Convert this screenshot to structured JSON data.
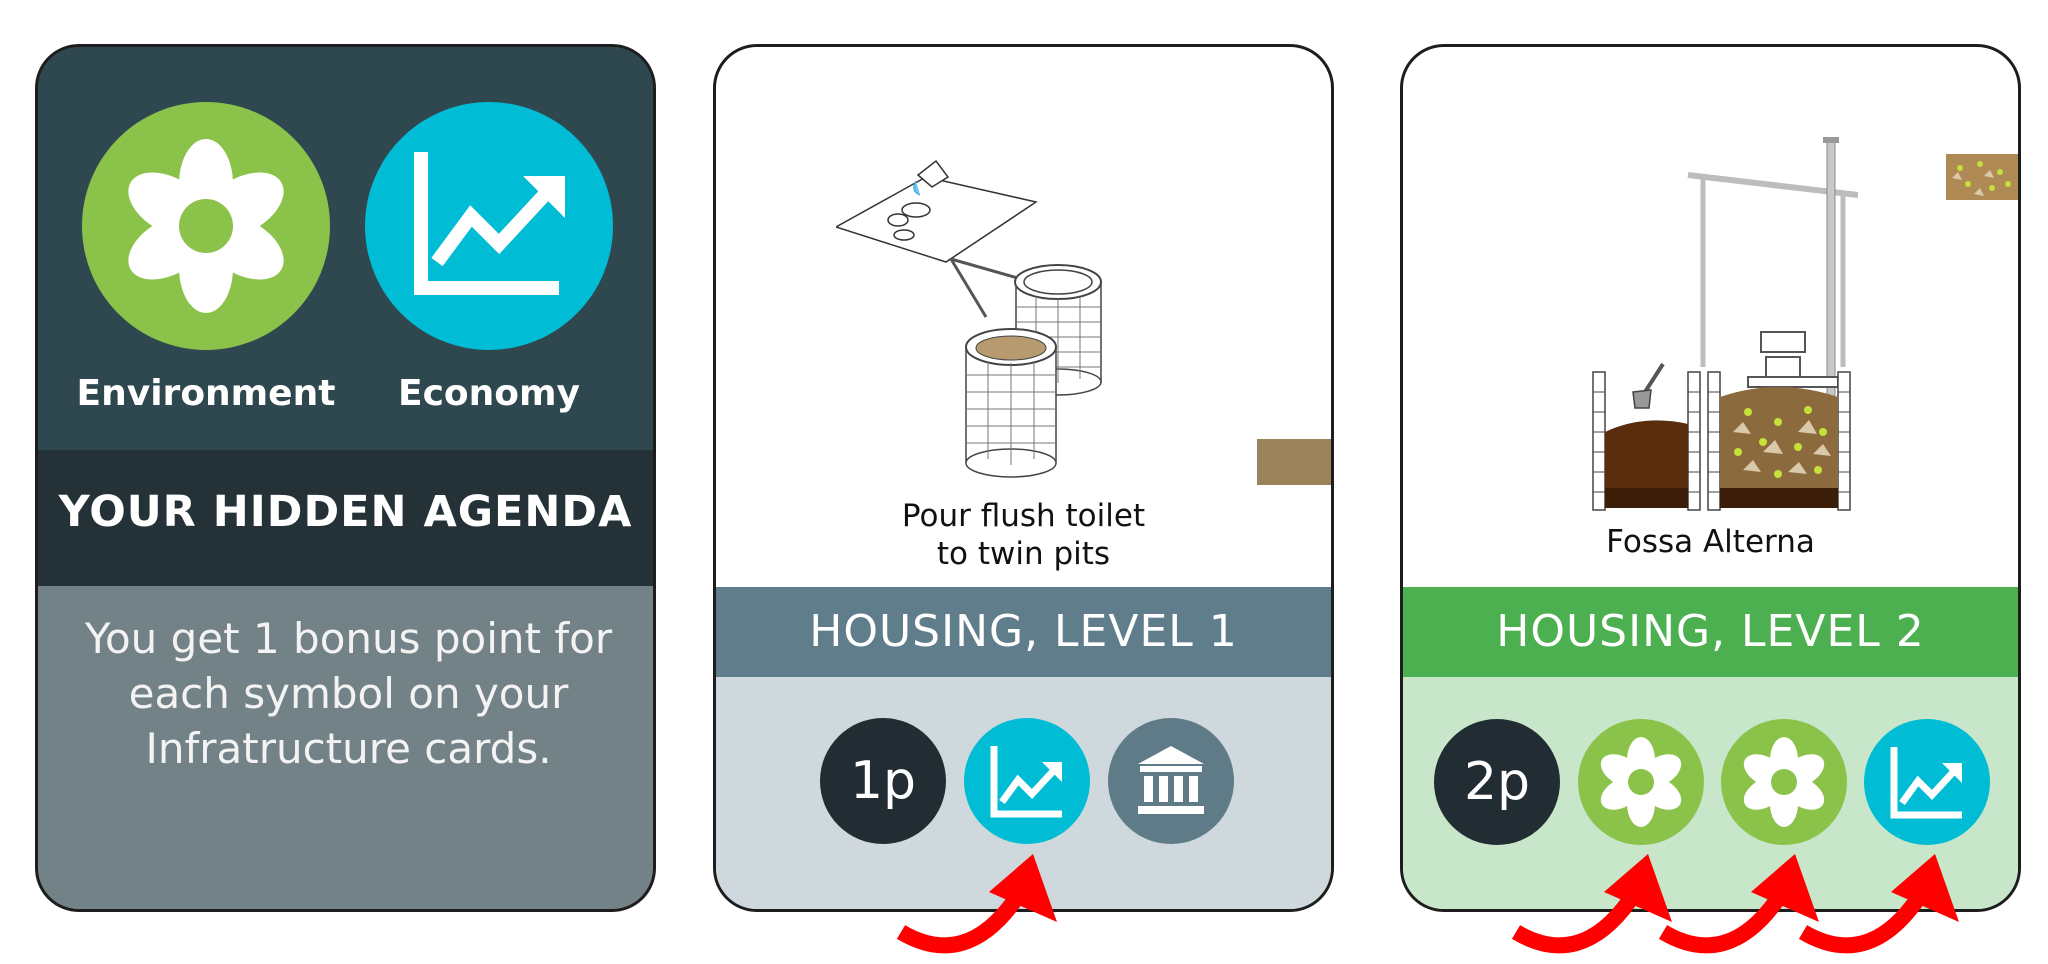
{
  "colors": {
    "environment": "#8bc34a",
    "economy": "#00bcd4",
    "governance": "#5f7b88",
    "dark_token": "#222d33",
    "level1_band": "#607d8b",
    "level1_lower": "#cfd8dc",
    "level2_band": "#4caf50",
    "level2_lower": "#c8e6c9",
    "arrow": "#ff0000"
  },
  "agenda_card": {
    "symbols": [
      {
        "icon": "flower-icon",
        "label": "Environment"
      },
      {
        "icon": "rising-chart-icon",
        "label": "Economy"
      }
    ],
    "title": "YOUR HIDDEN AGENDA",
    "text": "You get 1 bonus point for each symbol on your Infratructure cards."
  },
  "housing_cards": [
    {
      "caption_line1": "Pour flush toilet",
      "caption_line2": "to twin pits",
      "category": "HOUSING, LEVEL 1",
      "tokens": [
        {
          "type": "points",
          "label": "1p"
        },
        {
          "type": "economy",
          "icon": "rising-chart-icon"
        },
        {
          "type": "governance",
          "icon": "government-building-icon"
        }
      ],
      "highlight_arrows": 1
    },
    {
      "caption_line1": "Fossa Alterna",
      "category": "HOUSING, LEVEL 2",
      "tokens": [
        {
          "type": "points",
          "label": "2p"
        },
        {
          "type": "environment",
          "icon": "flower-icon"
        },
        {
          "type": "environment",
          "icon": "flower-icon"
        },
        {
          "type": "economy",
          "icon": "rising-chart-icon"
        }
      ],
      "highlight_arrows": 3
    }
  ]
}
